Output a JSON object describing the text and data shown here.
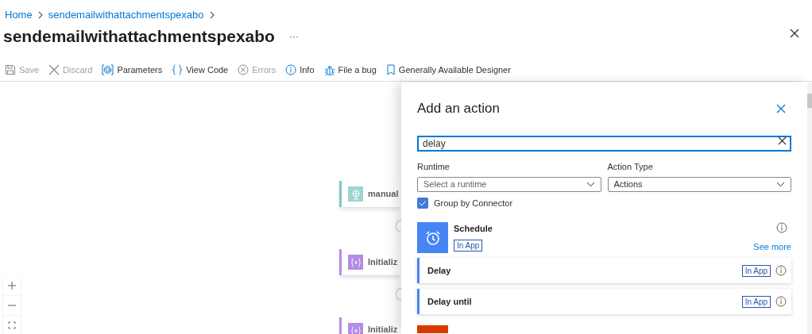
{
  "breadcrumb": [
    "Home",
    "sendemailwithattachmentspexabo"
  ],
  "title": "sendemailwithattachmentspexabo",
  "more_button": "···",
  "toolbar": [
    {
      "kind": "save",
      "label": "Save",
      "disabled": true
    },
    {
      "kind": "discard",
      "label": "Discard",
      "disabled": true
    },
    {
      "kind": "parameters",
      "label": "Parameters",
      "disabled": false
    },
    {
      "kind": "code",
      "label": "View Code",
      "disabled": false
    },
    {
      "kind": "errors",
      "label": "Errors",
      "disabled": true
    },
    {
      "kind": "info",
      "label": "Info",
      "disabled": false
    },
    {
      "kind": "bug",
      "label": "File a bug",
      "disabled": false
    },
    {
      "kind": "bookmark",
      "label": "Generally Available Designer",
      "disabled": false
    }
  ],
  "canvas_nodes": [
    {
      "kind": "trigger",
      "label": "manual"
    },
    {
      "kind": "variable",
      "label": "Initializ"
    },
    {
      "kind": "variable",
      "label": "Initializ"
    }
  ],
  "panel": {
    "title": "Add an action",
    "search": {
      "value": "delay"
    },
    "runtime": {
      "label": "Runtime",
      "placeholder": "Select a runtime"
    },
    "action_type": {
      "label": "Action Type",
      "value": "Actions"
    },
    "group_by_connector": {
      "label": "Group by Connector",
      "checked": true
    },
    "connector": {
      "name": "Schedule",
      "badge": "In App",
      "see_more": "See more"
    },
    "actions": [
      {
        "label": "Delay",
        "badge": "In App"
      },
      {
        "label": "Delay until",
        "badge": "In App"
      }
    ]
  }
}
